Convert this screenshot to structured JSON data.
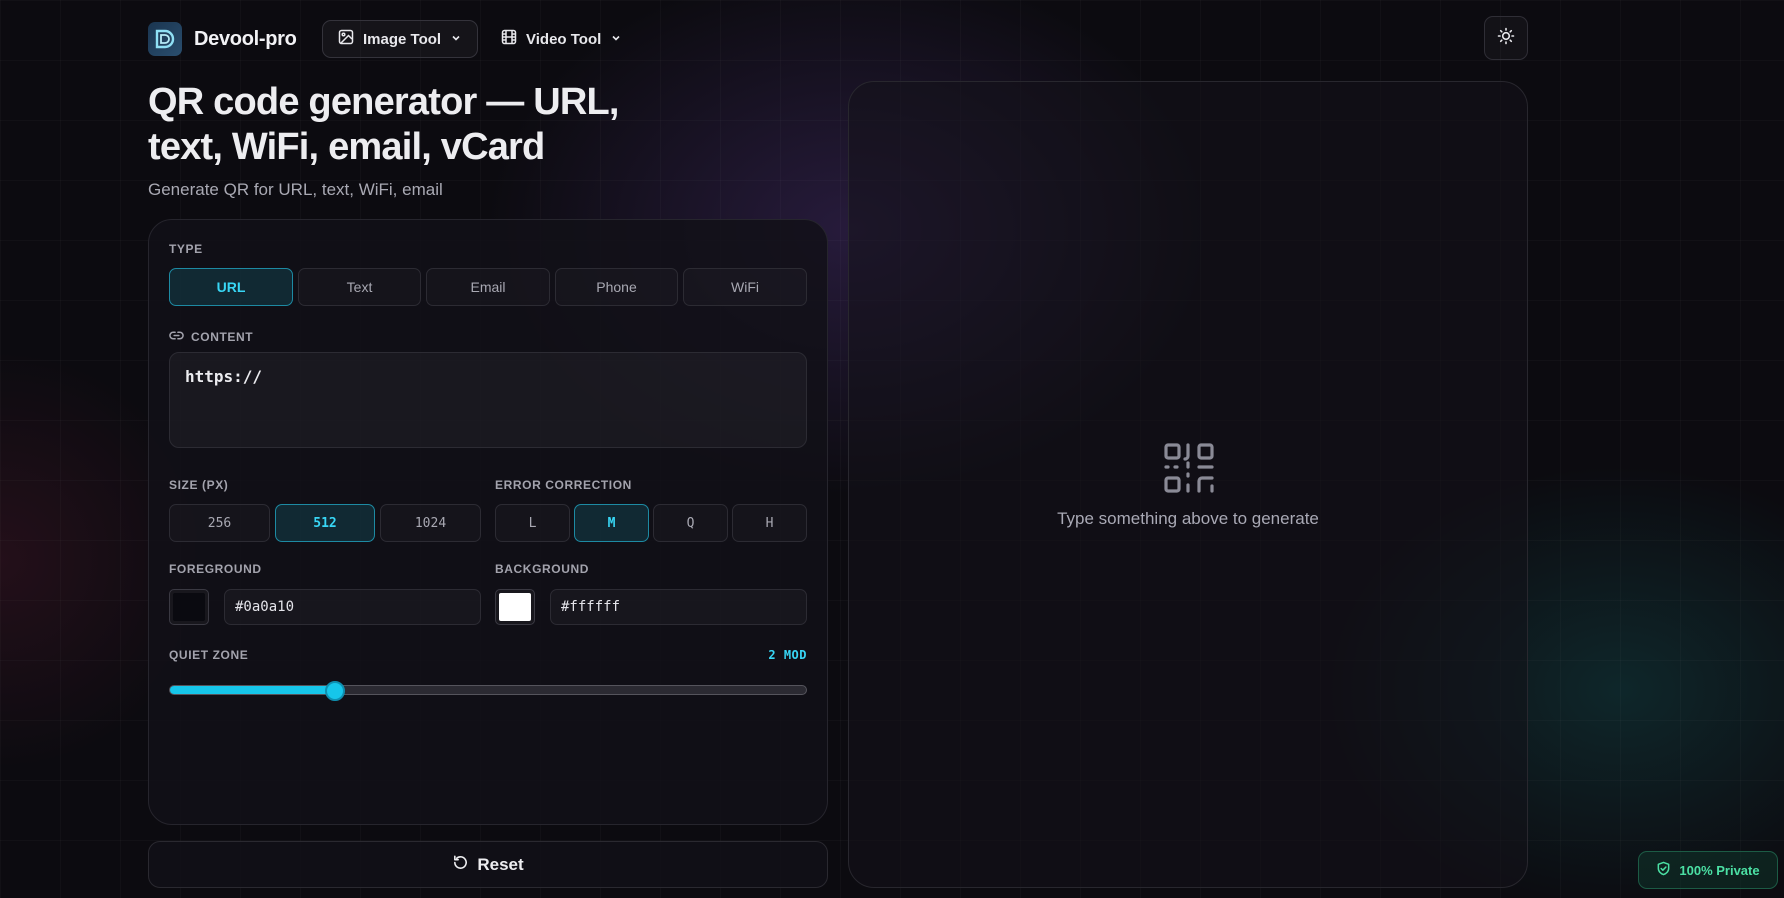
{
  "header": {
    "brand": "Devool-pro",
    "nav": [
      {
        "label": "Image Tool"
      },
      {
        "label": "Video Tool"
      }
    ]
  },
  "page": {
    "title": "QR code generator — URL, text, WiFi, email, vCard",
    "subtitle": "Generate QR for URL, text, WiFi, email"
  },
  "form": {
    "type_label": "TYPE",
    "types": [
      "URL",
      "Text",
      "Email",
      "Phone",
      "WiFi"
    ],
    "selected_type": "URL",
    "content_label": "CONTENT",
    "content_value": "https://",
    "size_label": "SIZE (PX)",
    "sizes": [
      "256",
      "512",
      "1024"
    ],
    "selected_size": "512",
    "ec_label": "ERROR CORRECTION",
    "ec_levels": [
      "L",
      "M",
      "Q",
      "H"
    ],
    "selected_ec": "M",
    "fg_label": "FOREGROUND",
    "fg_value": "#0a0a10",
    "bg_label": "BACKGROUND",
    "bg_value": "#ffffff",
    "quiet_label": "QUIET ZONE",
    "quiet_value_text": "2 MOD",
    "quiet_fraction": 0.26
  },
  "reset_label": "Reset",
  "preview": {
    "placeholder": "Type something above to generate",
    "icon": "qr-code-icon"
  },
  "badge": {
    "label": "100% Private"
  },
  "colors": {
    "accent": "#38d6f5",
    "slider": "#16c6ea",
    "private": "#4be0a4"
  }
}
